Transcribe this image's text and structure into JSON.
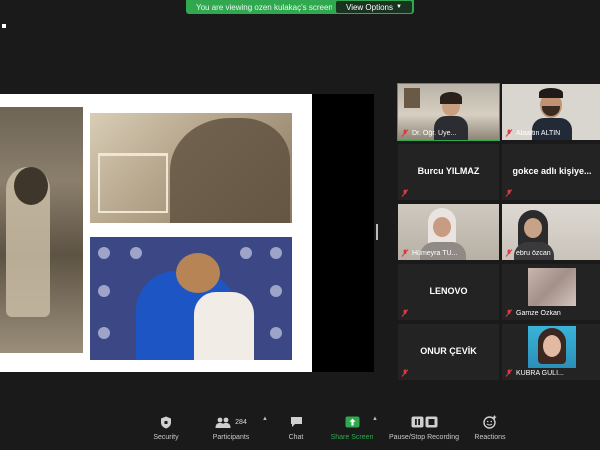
{
  "banner": {
    "text": "You are viewing ozen kulakaç's screen",
    "view_options": "View Options"
  },
  "gallery": [
    {
      "name": "Dr. Öğr. Üye...",
      "type": "video",
      "active": true
    },
    {
      "name": "Alaattin ALTIN",
      "type": "video",
      "active": false
    },
    {
      "name": "Burcu YILMAZ",
      "type": "name",
      "active": false
    },
    {
      "name": "gokce adlı kişiye...",
      "type": "name",
      "active": false
    },
    {
      "name": "Hümeyra TU...",
      "type": "video",
      "active": false
    },
    {
      "name": "ebru özcan",
      "type": "video",
      "active": false
    },
    {
      "name": "LENOVO",
      "type": "name",
      "active": false
    },
    {
      "name": "Gamze Özkan",
      "type": "photo",
      "active": false
    },
    {
      "name": "ONUR ÇEVİK",
      "type": "name",
      "active": false
    },
    {
      "name": "KÜBRA GÜLİ...",
      "type": "photo",
      "active": false
    }
  ],
  "toolbar": {
    "security": "Security",
    "participants": "Participants",
    "participants_count": "284",
    "chat": "Chat",
    "share_screen": "Share Screen",
    "recording": "Pause/Stop Recording",
    "reactions": "Reactions"
  },
  "colors": {
    "accent": "#2fa84f",
    "muted_mic": "#e0383e",
    "background": "#1a1a1a"
  },
  "icons": [
    "shield-icon",
    "participants-icon",
    "chat-icon",
    "share-screen-icon",
    "pause-stop-icon",
    "reactions-icon",
    "muted-mic-icon"
  ]
}
